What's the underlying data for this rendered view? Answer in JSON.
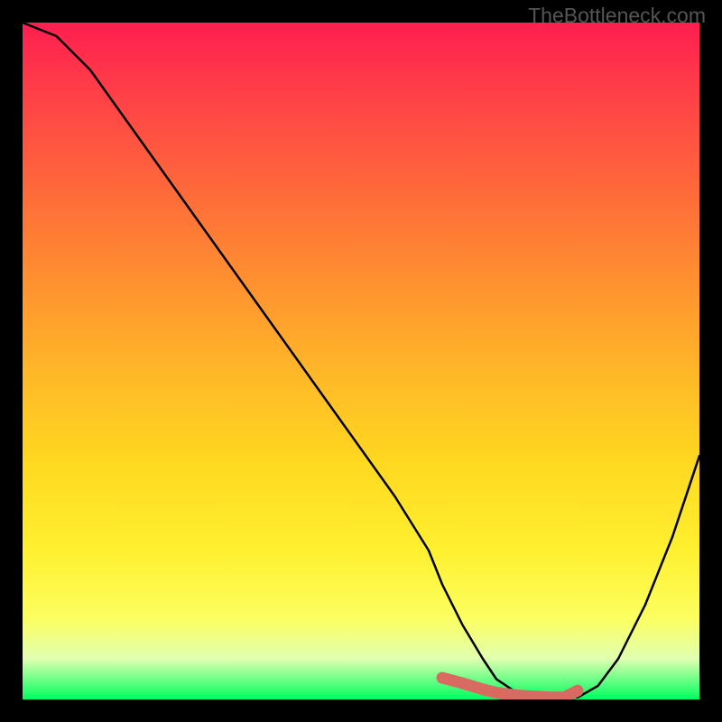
{
  "watermark": "TheBottleneck.com",
  "chart_data": {
    "type": "line",
    "title": "",
    "xlabel": "",
    "ylabel": "",
    "xlim": [
      0,
      100
    ],
    "ylim": [
      0,
      100
    ],
    "series": [
      {
        "name": "bottleneck-curve",
        "x": [
          0,
          5,
          10,
          15,
          20,
          25,
          30,
          35,
          40,
          45,
          50,
          55,
          60,
          62,
          65,
          68,
          70,
          73,
          76,
          78,
          80,
          82,
          85,
          88,
          92,
          96,
          100
        ],
        "y": [
          100,
          98,
          93,
          86,
          79,
          72,
          65,
          58,
          51,
          44,
          37,
          30,
          22,
          17,
          11,
          6,
          3,
          1,
          0.4,
          0.3,
          0.3,
          0.3,
          2,
          6,
          14,
          24,
          36
        ]
      }
    ],
    "highlight": {
      "name": "optimal-range",
      "x": [
        62,
        65,
        68,
        70,
        73,
        76,
        78,
        80,
        82
      ],
      "y": [
        3.2,
        2.4,
        1.5,
        1.0,
        0.6,
        0.4,
        0.3,
        0.3,
        1.3
      ]
    },
    "gradient_stops": [
      {
        "pos": 0.0,
        "color": "#ff1e50"
      },
      {
        "pos": 0.5,
        "color": "#ffb828"
      },
      {
        "pos": 0.85,
        "color": "#fcff60"
      },
      {
        "pos": 1.0,
        "color": "#00ff60"
      }
    ]
  }
}
